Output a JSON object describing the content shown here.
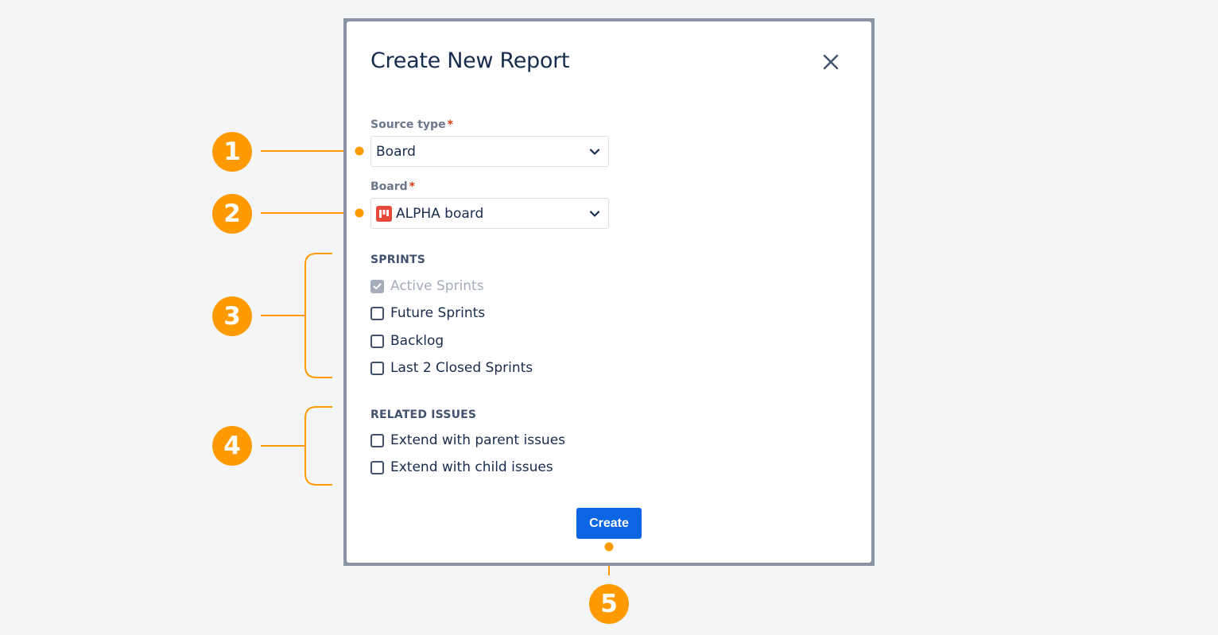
{
  "modal": {
    "title": "Create New Report",
    "close_glyph": "close-icon"
  },
  "form": {
    "source_type": {
      "label": "Source type",
      "required_mark": "*",
      "value": "Board"
    },
    "board": {
      "label": "Board",
      "required_mark": "*",
      "value": "ALPHA board",
      "icon": "board-icon",
      "icon_color": "#e5493a"
    },
    "sprints": {
      "heading": "SPRINTS",
      "options": [
        {
          "label": "Active Sprints",
          "checked": true,
          "disabled": true
        },
        {
          "label": "Future Sprints",
          "checked": false,
          "disabled": false
        },
        {
          "label": "Backlog",
          "checked": false,
          "disabled": false
        },
        {
          "label": "Last 2 Closed Sprints",
          "checked": false,
          "disabled": false
        }
      ]
    },
    "related_issues": {
      "heading": "RELATED ISSUES",
      "options": [
        {
          "label": "Extend with parent issues",
          "checked": false
        },
        {
          "label": "Extend with child issues",
          "checked": false
        }
      ]
    },
    "create_label": "Create"
  },
  "callouts": [
    "1",
    "2",
    "3",
    "4",
    "5"
  ],
  "colors": {
    "accent": "#ff9a00",
    "primary_button": "#0c66e4",
    "frame": "#8993a4",
    "background": "#f4f5f7"
  }
}
